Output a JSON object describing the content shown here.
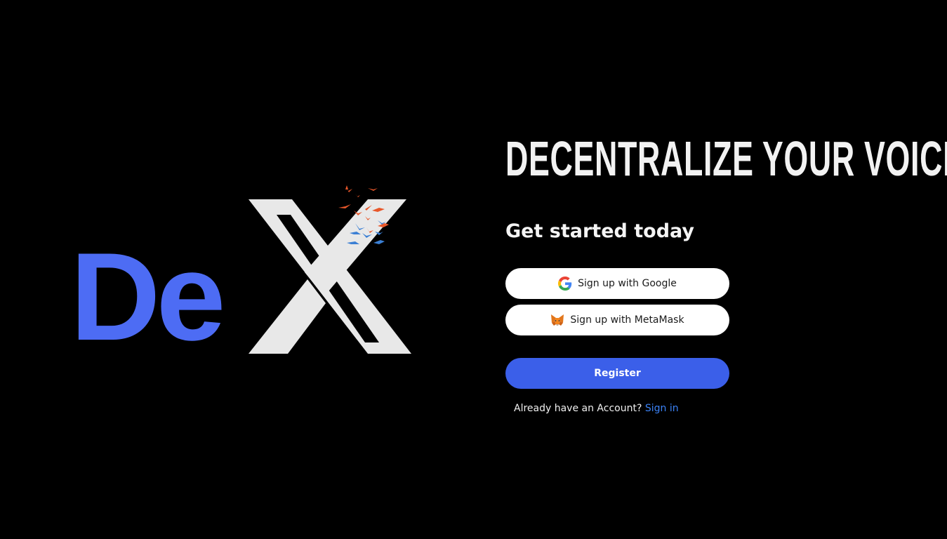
{
  "logo": {
    "text_de": "De",
    "text_x": "X",
    "colors": {
      "de": "#4d6cf4",
      "x": "#e8e8e8",
      "bird_orange": "#e8572a",
      "bird_blue": "#3b7fd4"
    }
  },
  "hero": {
    "headline": "DECENTRALIZE YOUR VOICE",
    "subheadline": "Get started today"
  },
  "auth": {
    "google_label": "Sign up with Google",
    "google_icon": "google-icon",
    "metamask_label": "Sign up with MetaMask",
    "metamask_icon": "metamask-fox-icon",
    "register_label": "Register",
    "already_text": "Already have an Account?",
    "signin_label": "Sign in"
  },
  "colors": {
    "background": "#000000",
    "primary": "#3b5fe9",
    "link": "#3b82f6"
  }
}
